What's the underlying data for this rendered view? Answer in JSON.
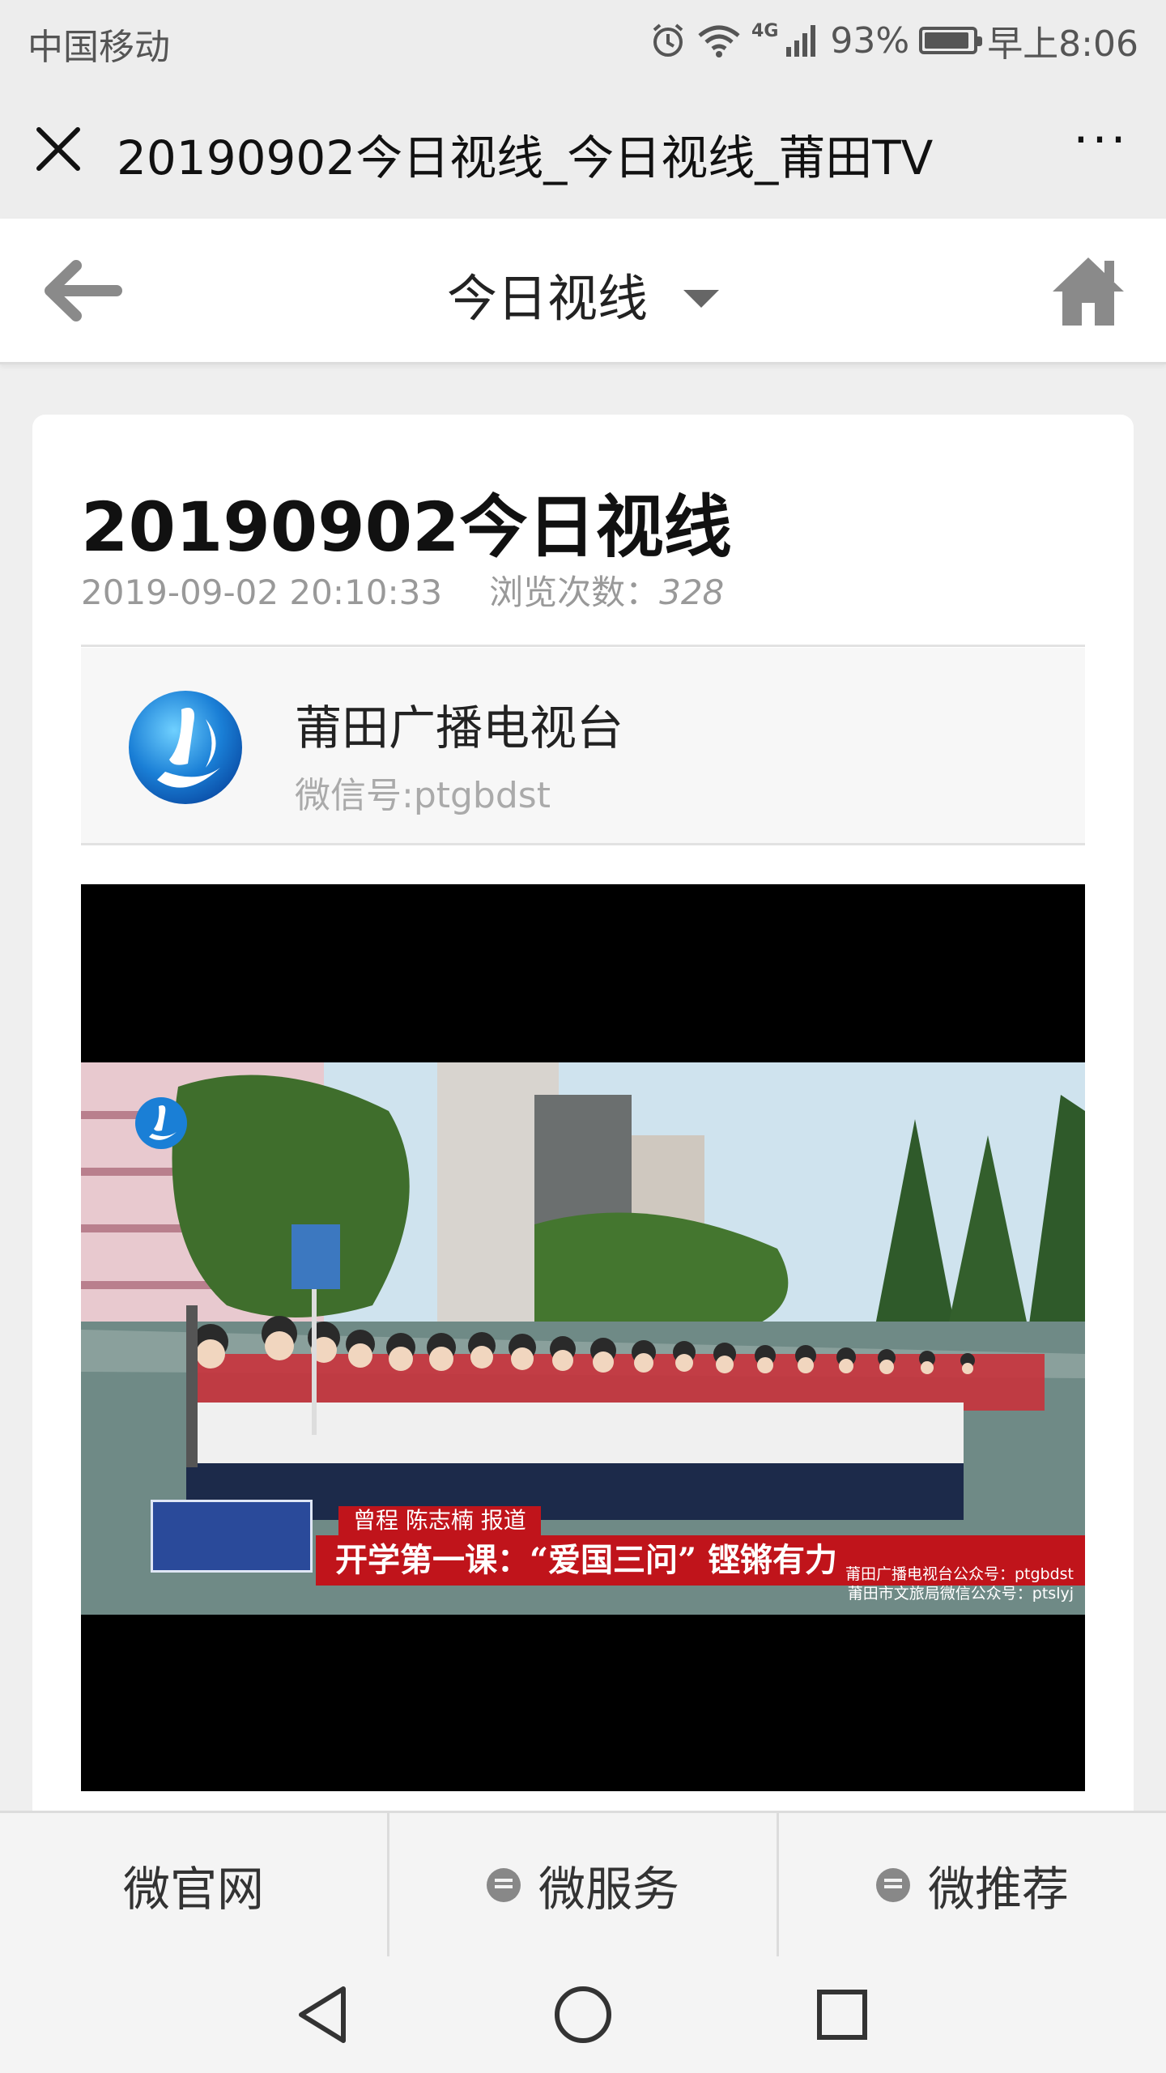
{
  "status_bar": {
    "carrier": "中国移动",
    "network": "4G",
    "battery_percent": "93%",
    "battery_level": 0.93,
    "time": "早上8:06"
  },
  "wechat_bar": {
    "title": "20190902今日视线_今日视线_莆田TV",
    "more": "···"
  },
  "site_header": {
    "title": "今日视线"
  },
  "article": {
    "title": "20190902今日视线",
    "datetime": "2019-09-02 20:10:33",
    "views_label": "浏览次数：",
    "views": "328"
  },
  "account": {
    "name": "莆田广播电视台",
    "wechat_id": "微信号:ptgbdst"
  },
  "video": {
    "reporter_caption": "曾程  陈志楠  报道",
    "headline_caption": "开学第一课：“爱国三问” 铿锵有力",
    "sub_caption_1": "莆田广播电视台公众号：ptgbdst",
    "sub_caption_2": "莆田市文旅局微信公众号：ptslyj"
  },
  "bottom_nav": {
    "items": [
      {
        "label": "微官网"
      },
      {
        "label": "微服务"
      },
      {
        "label": "微推荐"
      }
    ]
  }
}
